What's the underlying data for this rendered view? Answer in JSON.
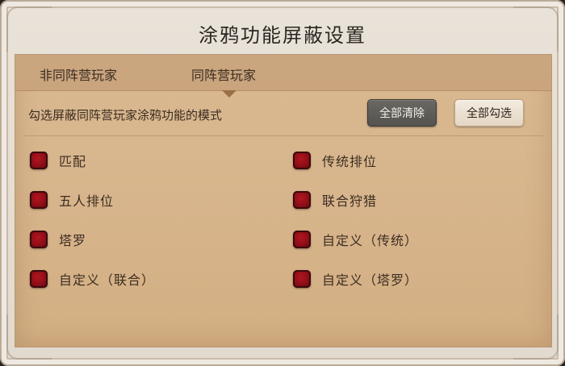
{
  "title": "涂鸦功能屏蔽设置",
  "tabs": [
    {
      "label": "非同阵营玩家"
    },
    {
      "label": "同阵营玩家"
    }
  ],
  "active_tab": 1,
  "hint": "勾选屏蔽同阵营玩家涂鸦功能的模式",
  "buttons": {
    "clear_label": "全部清除",
    "select_all_label": "全部勾选"
  },
  "options": [
    {
      "label": "匹配",
      "checked": true
    },
    {
      "label": "传统排位",
      "checked": true
    },
    {
      "label": "五人排位",
      "checked": true
    },
    {
      "label": "联合狩猎",
      "checked": true
    },
    {
      "label": "塔罗",
      "checked": true
    },
    {
      "label": "自定义（传统）",
      "checked": true
    },
    {
      "label": "自定义（联合）",
      "checked": true
    },
    {
      "label": "自定义（塔罗）",
      "checked": true
    }
  ],
  "colors": {
    "checkbox_red": "#8c0d16",
    "panel_bg": "#d8b68d"
  }
}
